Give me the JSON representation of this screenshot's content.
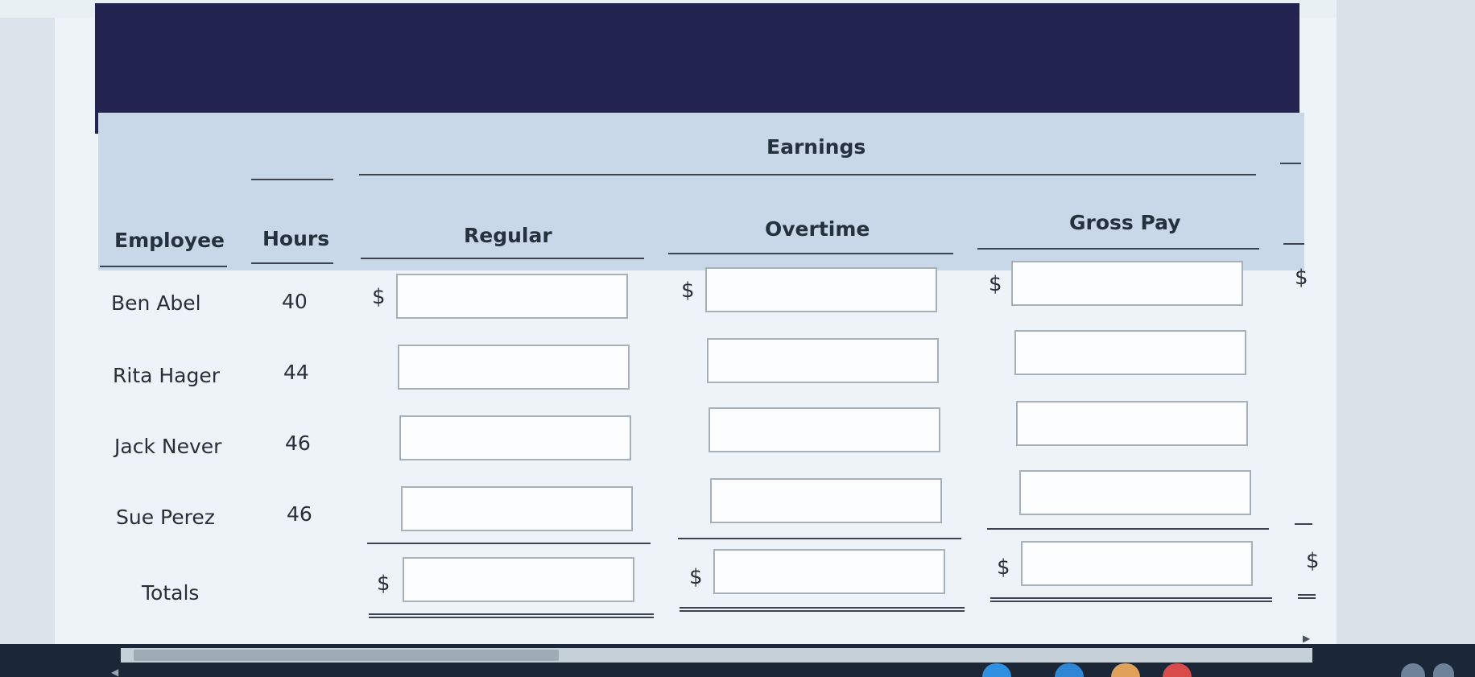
{
  "header": {
    "earnings": "Earnings",
    "employee": "Employee",
    "hours": "Hours",
    "regular": "Regular",
    "overtime": "Overtime",
    "gross_pay": "Gross Pay"
  },
  "currency_symbol": "$",
  "rows": [
    {
      "name": "Ben Abel",
      "hours": "40"
    },
    {
      "name": "Rita Hager",
      "hours": "44"
    },
    {
      "name": "Jack Never",
      "hours": "46"
    },
    {
      "name": "Sue Perez",
      "hours": "46"
    }
  ],
  "totals_label": "Totals",
  "colors": {
    "dark_header": "#232350",
    "blue_header": "#c8d8e8",
    "input_border": "#a7b1ba"
  }
}
